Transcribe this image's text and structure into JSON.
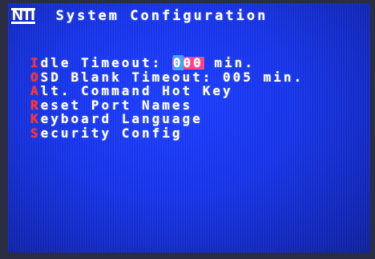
{
  "header": {
    "logo": "NTI",
    "title": "System Configuration"
  },
  "menu": {
    "items": [
      {
        "hotkey": "I",
        "label": "dle Timeout: ",
        "value_first": "0",
        "value_rest": "00",
        "suffix": " min."
      },
      {
        "hotkey": "O",
        "label": "SD Blank Timeout: 005 min."
      },
      {
        "hotkey": "A",
        "label": "lt. Command Hot Key"
      },
      {
        "hotkey": "R",
        "label": "eset Port Names"
      },
      {
        "hotkey": "K",
        "label": "eyboard Language"
      },
      {
        "hotkey": "S",
        "label": "ecurity Config"
      }
    ]
  },
  "colors": {
    "screen_bg": "#1432e6",
    "text": "#f4f6ff",
    "hotkey": "#ff2c2c",
    "highlight": "#ff3d8b",
    "cursor": "#3aa0ff"
  }
}
